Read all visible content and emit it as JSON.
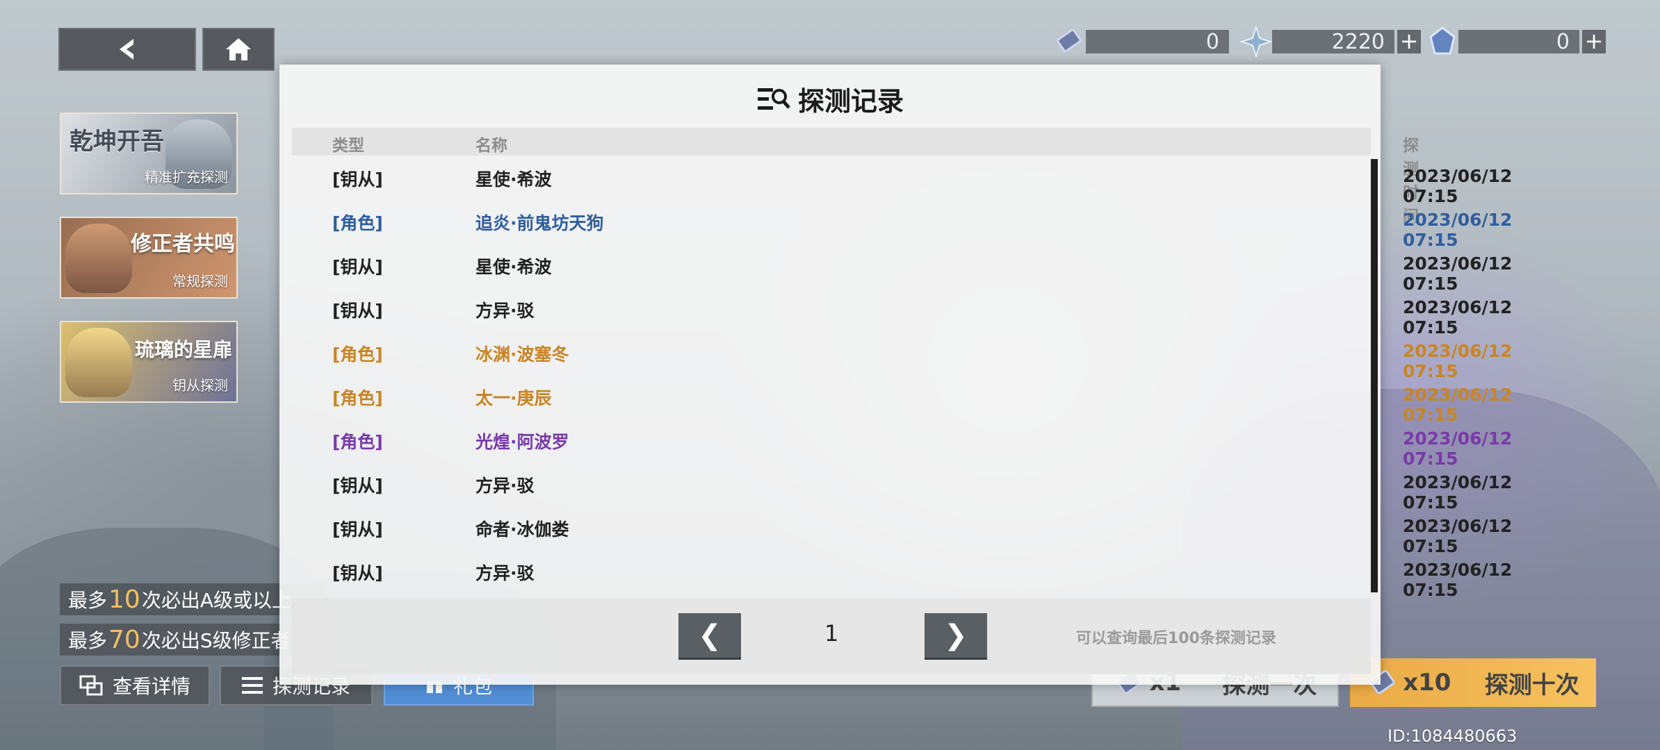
{
  "colors": {
    "white_rarity": "#222222",
    "blue_rarity": "#2f5e9e",
    "orange_rarity": "#c98524",
    "purple_rarity": "#7a3aa8",
    "accent_gold": "#f2b84b"
  },
  "currencies": [
    {
      "icon": "ticket-icon",
      "value": "0",
      "has_plus": false
    },
    {
      "icon": "star-crystal-icon",
      "value": "2220",
      "has_plus": true
    },
    {
      "icon": "gem-icon",
      "value": "0",
      "has_plus": true
    }
  ],
  "banners": [
    {
      "title": "乾坤开吾",
      "subtitle": "精准扩充探测"
    },
    {
      "title": "修正者共鸣",
      "subtitle": "常规探测"
    },
    {
      "title": "琉璃的星扉",
      "subtitle": "钥从探测"
    }
  ],
  "info": {
    "line1_prefix": "最多",
    "line1_num": "10",
    "line1_suffix": "次必出A级或以上",
    "line2_prefix": "最多",
    "line2_num": "70",
    "line2_suffix": "次必出S级修正者"
  },
  "bottom_buttons": {
    "details": "查看详情",
    "records": "探测记录",
    "gift": "礼包"
  },
  "draw": {
    "single_count": "x1",
    "single_label": "探测一次",
    "ten_count": "x10",
    "ten_label": "探测十次"
  },
  "user_id": "ID:1084480663",
  "modal": {
    "title": "探测记录",
    "headers": {
      "type": "类型",
      "name": "名称",
      "time": "探测时间"
    },
    "rows": [
      {
        "type": "[钥从]",
        "name": "星使·希波",
        "time": "2023/06/12 07:15",
        "rarity": "white"
      },
      {
        "type": "[角色]",
        "name": "追炎·前鬼坊天狗",
        "time": "2023/06/12 07:15",
        "rarity": "blue"
      },
      {
        "type": "[钥从]",
        "name": "星使·希波",
        "time": "2023/06/12 07:15",
        "rarity": "white"
      },
      {
        "type": "[钥从]",
        "name": "方异·驳",
        "time": "2023/06/12 07:15",
        "rarity": "white"
      },
      {
        "type": "[角色]",
        "name": "冰渊·波塞冬",
        "time": "2023/06/12 07:15",
        "rarity": "orange"
      },
      {
        "type": "[角色]",
        "name": "太一·庚辰",
        "time": "2023/06/12 07:15",
        "rarity": "orange"
      },
      {
        "type": "[角色]",
        "name": "光煌·阿波罗",
        "time": "2023/06/12 07:15",
        "rarity": "purple"
      },
      {
        "type": "[钥从]",
        "name": "方异·驳",
        "time": "2023/06/12 07:15",
        "rarity": "white"
      },
      {
        "type": "[钥从]",
        "name": "命者·冰伽娄",
        "time": "2023/06/12 07:15",
        "rarity": "white"
      },
      {
        "type": "[钥从]",
        "name": "方异·驳",
        "time": "2023/06/12 07:15",
        "rarity": "white"
      }
    ],
    "pager": {
      "prev": "❮",
      "next": "❯",
      "page": "1",
      "note": "可以查询最后100条探测记录"
    }
  }
}
